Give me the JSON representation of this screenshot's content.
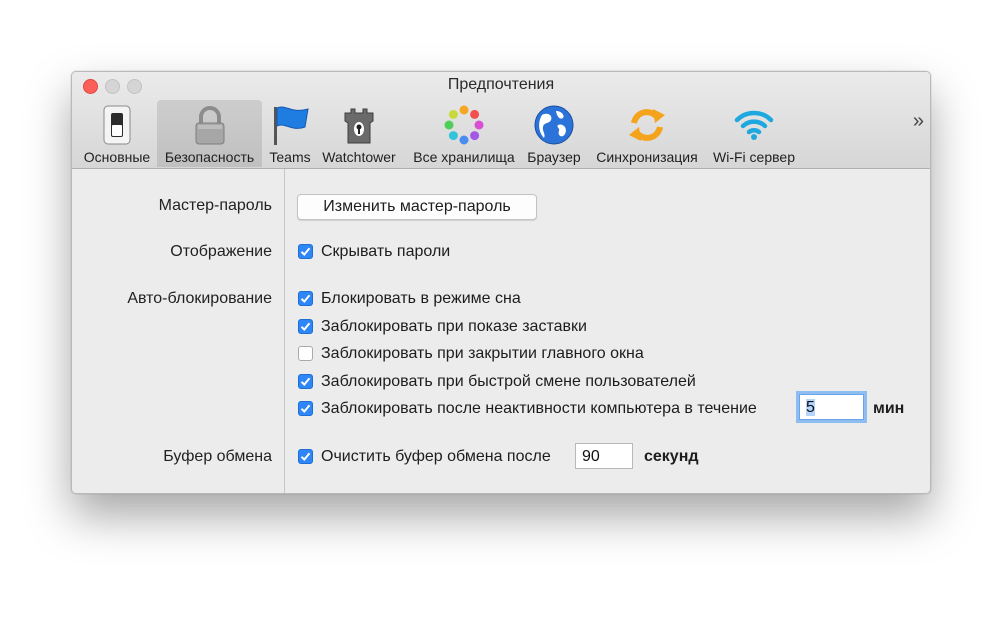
{
  "window": {
    "title": "Предпочтения"
  },
  "toolbar": {
    "tabs": [
      {
        "label": "Основные",
        "icon": "switch-icon"
      },
      {
        "label": "Безопасность",
        "icon": "lock-icon",
        "active": true
      },
      {
        "label": "Teams",
        "icon": "flag-icon"
      },
      {
        "label": "Watchtower",
        "icon": "tower-icon"
      },
      {
        "label": "Все хранилища",
        "icon": "vaults-ring-icon"
      },
      {
        "label": "Браузер",
        "icon": "globe-icon"
      },
      {
        "label": "Синхронизация",
        "icon": "sync-icon"
      },
      {
        "label": "Wi-Fi сервер",
        "icon": "wifi-icon"
      }
    ],
    "overflow": "»"
  },
  "security": {
    "master_password": {
      "label": "Мастер-пароль",
      "button": "Изменить мастер-пароль"
    },
    "display": {
      "label": "Отображение",
      "hide_passwords": {
        "text": "Скрывать пароли",
        "checked": true
      }
    },
    "auto_lock": {
      "label": "Авто-блокирование",
      "options": [
        {
          "text": "Блокировать в режиме сна",
          "checked": true
        },
        {
          "text": "Заблокировать при показе заставки",
          "checked": true
        },
        {
          "text": "Заблокировать при закрытии главного окна",
          "checked": false
        },
        {
          "text": "Заблокировать при быстрой смене пользователей",
          "checked": true
        },
        {
          "text": "Заблокировать после неактивности компьютера в течение",
          "checked": true
        }
      ],
      "idle_minutes": "5",
      "idle_unit": "мин"
    },
    "clipboard": {
      "label": "Буфер обмена",
      "clear": {
        "text": "Очистить буфер обмена после",
        "checked": true
      },
      "seconds": "90",
      "unit": "секунд"
    }
  },
  "colors": {
    "accent": "#2f86f7",
    "close": "#fc5f57"
  }
}
